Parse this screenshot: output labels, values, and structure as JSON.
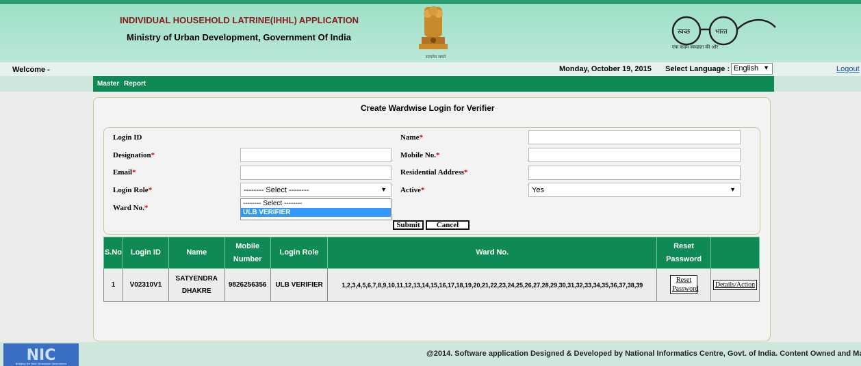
{
  "header": {
    "app_title": "INDIVIDUAL HOUSEHOLD LATRINE(IHHL) APPLICATION",
    "ministry": "Ministry of Urban Development, Government Of India",
    "emblem_caption": "सत्यमेव जयते",
    "swachh_left": "स्वच्छ",
    "swachh_right": "भारत",
    "swachh_tagline": "एक कदम स्वच्छता की ओर"
  },
  "topbar": {
    "welcome": "Welcome -",
    "date": "Monday, October 19, 2015",
    "language_label": "Select Language :",
    "language_value": "English",
    "logout": "Logout"
  },
  "menu": {
    "items": [
      "Master",
      "Report"
    ]
  },
  "form": {
    "title": "Create Wardwise Login for Verifier",
    "labels": {
      "login_id": "Login ID",
      "designation": "Designation",
      "email": "Email",
      "login_role": "Login Role",
      "ward_no": "Ward No.",
      "name": "Name",
      "mobile": "Mobile No.",
      "address": "Residential Address",
      "active": "Active"
    },
    "required_mark": "*",
    "login_role_value": "-------- Select --------",
    "login_role_options": [
      "-------- Select --------",
      "ULB VERIFIER"
    ],
    "active_value": "Yes",
    "submit": "Submit",
    "cancel": "Cancel"
  },
  "table": {
    "headers": [
      "S.No",
      "Login ID",
      "Name",
      "Mobile Number",
      "Login Role",
      "Ward No.",
      "Reset Password",
      ""
    ],
    "rows": [
      {
        "sno": "1",
        "login_id": "V02310V1",
        "name": "SATYENDRA DHAKRE",
        "mobile": "9826256356",
        "role": "ULB VERIFIER",
        "wards": "1,2,3,4,5,6,7,8,9,10,11,12,13,14,15,16,17,18,19,20,21,22,23,24,25,26,27,28,29,30,31,32,33,34,35,36,37,38,39",
        "reset": "Reset Password",
        "action": "Details/Action"
      }
    ]
  },
  "footer": {
    "nic_text": "NIC",
    "nic_tagline": "Bridging the Next Generation Government",
    "text": "@2014. Software application Designed & Developed by National Informatics Centre, Govt. of India. Content Owned and Ma"
  },
  "colors": {
    "primary_green": "#0f8a55",
    "header_bg": "#a8e3cd",
    "title_red": "#8b1a1a",
    "link_blue": "#1a4fa8"
  }
}
